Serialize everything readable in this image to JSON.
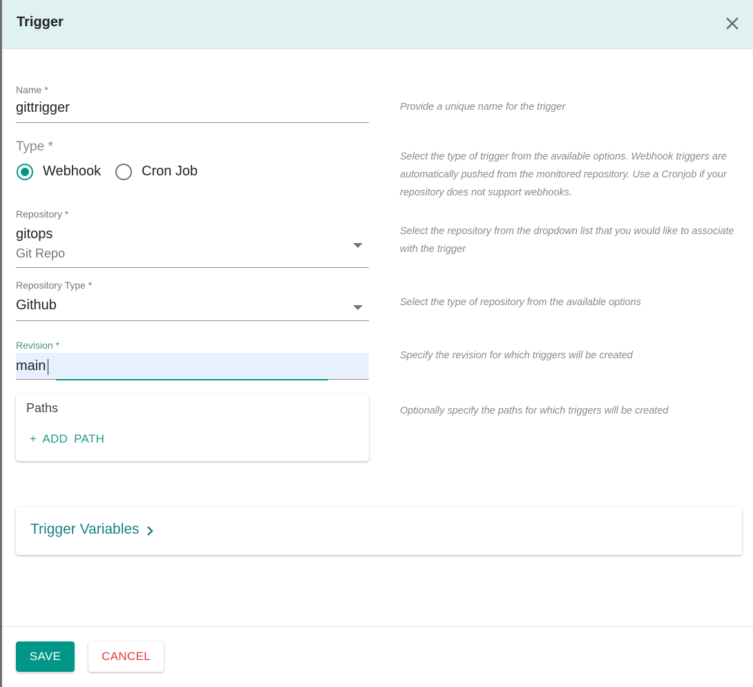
{
  "dialog": {
    "title": "Trigger",
    "close_icon": "close-icon"
  },
  "form": {
    "name": {
      "label": "Name *",
      "value": "gittrigger",
      "help": "Provide a unique name for the trigger"
    },
    "type": {
      "label": "Type *",
      "options": [
        {
          "label": "Webhook",
          "checked": true
        },
        {
          "label": "Cron Job",
          "checked": false
        }
      ],
      "help": "Select the type of trigger from the available options. Webhook triggers are automatically pushed from the monitored repository. Use a Cronjob if your repository does not support webhooks."
    },
    "repository": {
      "label": "Repository *",
      "value": "gitops",
      "subtext": "Git Repo",
      "help": "Select the repository from the dropdown list that you would like to associate with the trigger"
    },
    "repository_type": {
      "label": "Repository Type *",
      "value": "Github",
      "help": "Select the type of repository from the available options"
    },
    "revision": {
      "label": "Revision *",
      "value": "main",
      "help": "Specify the revision for which triggers will be created"
    },
    "paths": {
      "title": "Paths",
      "add_label": "+ ADD PATH",
      "help": "Optionally specify the paths for which triggers will be created"
    },
    "trigger_variables": {
      "label": "Trigger Variables"
    }
  },
  "footer": {
    "save_label": "SAVE",
    "cancel_label": "CANCEL"
  },
  "colors": {
    "accent": "#009688",
    "header_bg": "#dff1f0",
    "cancel_text": "#e53935",
    "link_text": "#1a7f85"
  }
}
